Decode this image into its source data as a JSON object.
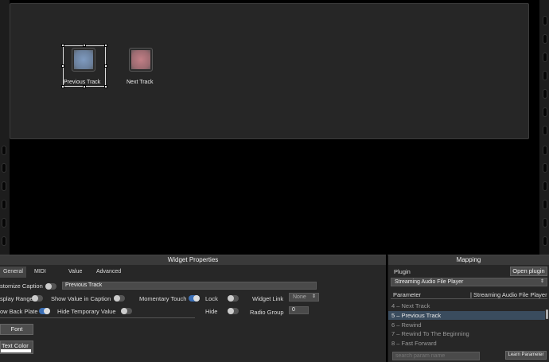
{
  "canvas": {
    "pads": [
      {
        "label": "Previous Track",
        "color": "#7f9bc0"
      },
      {
        "label": "Next Track",
        "color": "#c27f86"
      }
    ]
  },
  "widget_properties": {
    "title": "Widget Properties",
    "tabs": [
      "General",
      "MIDI",
      "Value",
      "Advanced"
    ],
    "active_tab": "General",
    "customize_caption_label": "stomize Caption",
    "caption_value": "Previous Track",
    "display_range_label": "splay Range",
    "show_value_label": "Show Value in Caption",
    "momentary_touch_label": "Momentary Touch",
    "lock_label": "Lock",
    "widget_link_label": "Widget Link",
    "widget_link_value": "None",
    "back_plate_label": "ow Back Plate",
    "hide_temp_label": "Hide Temporary Value",
    "hide_label": "Hide",
    "radio_group_label": "Radio Group",
    "radio_group_value": "0",
    "font_button": "Font",
    "text_color_button": "Text Color"
  },
  "mapping": {
    "title": "Mapping",
    "plugin_label": "Plugin",
    "open_plugin_button": "Open plugin",
    "plugin_select": "Streaming Audio File Player",
    "param_header": "Parameter",
    "plugin_header": "| Streaming Audio File Player",
    "params": [
      {
        "label": "4 – Next Track",
        "selected": false
      },
      {
        "label": "5 – Previous Track",
        "selected": true
      },
      {
        "label": "6 – Rewind",
        "selected": false
      },
      {
        "label": "7 – Rewind To The Beginning",
        "selected": false
      },
      {
        "label": "8 – Fast Forward",
        "selected": false
      }
    ],
    "search_placeholder": "search param name",
    "learn_button": "Learn Parameter"
  }
}
